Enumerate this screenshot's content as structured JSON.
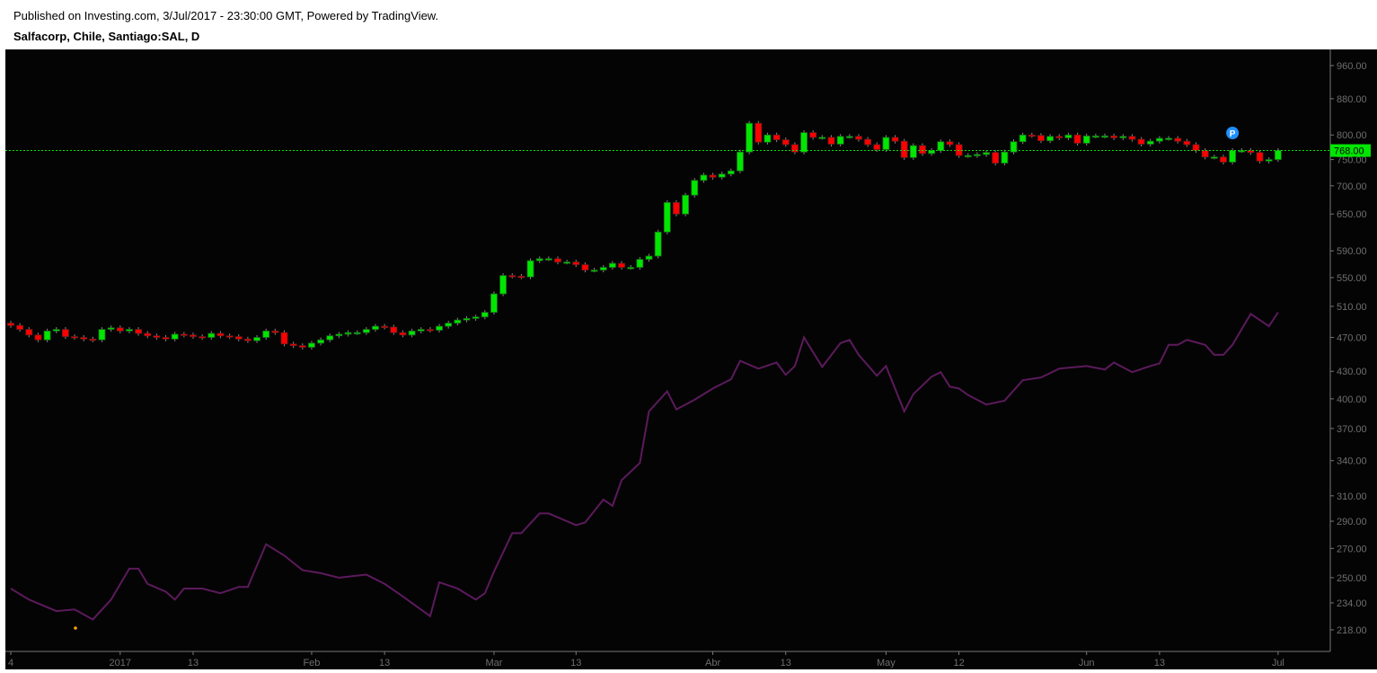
{
  "header": {
    "published": "Published on Investing.com, 3/Jul/2017 - 23:30:00 GMT, Powered by TradingView.",
    "symbol": "Salfacorp, Chile, Santiago:SAL, D"
  },
  "chart_data": {
    "type": "candlestick",
    "title": "Salfacorp, Chile, Santiago:SAL, D",
    "scale": "log",
    "ylim": [
      210,
      990
    ],
    "y_ticks": [
      "960.00",
      "880.00",
      "800.00",
      "750.00",
      "700.00",
      "650.00",
      "590.00",
      "550.00",
      "510.00",
      "470.00",
      "430.00",
      "400.00",
      "370.00",
      "340.00",
      "310.00",
      "290.00",
      "270.00",
      "250.00",
      "234.00",
      "218.00"
    ],
    "x_ticks": [
      {
        "label": "4",
        "index": 0
      },
      {
        "label": "2017",
        "index": 12
      },
      {
        "label": "13",
        "index": 20
      },
      {
        "label": "Feb",
        "index": 33
      },
      {
        "label": "13",
        "index": 41
      },
      {
        "label": "Mar",
        "index": 53
      },
      {
        "label": "13",
        "index": 62
      },
      {
        "label": "Abr",
        "index": 77
      },
      {
        "label": "13",
        "index": 85
      },
      {
        "label": "May",
        "index": 96
      },
      {
        "label": "12",
        "index": 104
      },
      {
        "label": "Jun",
        "index": 118
      },
      {
        "label": "13",
        "index": 126
      },
      {
        "label": "Jul",
        "index": 139
      }
    ],
    "last_price": "768.00",
    "last_value": 768,
    "colors": {
      "up": "#00e600",
      "down": "#ff0000",
      "compare": "#5c1a5c",
      "last": "#00e600"
    },
    "closes": [
      485,
      480,
      473,
      467,
      478,
      480,
      471,
      470,
      468,
      467,
      480,
      482,
      478,
      480,
      475,
      472,
      470,
      468,
      474,
      473,
      471,
      470,
      475,
      472,
      471,
      468,
      466,
      470,
      478,
      476,
      462,
      460,
      458,
      463,
      467,
      472,
      474,
      476,
      476,
      480,
      484,
      483,
      476,
      473,
      478,
      480,
      479,
      484,
      488,
      492,
      494,
      496,
      502,
      527,
      553,
      552,
      551,
      575,
      578,
      578,
      573,
      573,
      569,
      561,
      561,
      565,
      571,
      565,
      565,
      577,
      582,
      620,
      670,
      650,
      683,
      710,
      720,
      716,
      722,
      728,
      765,
      825,
      785,
      800,
      790,
      780,
      765,
      805,
      795,
      795,
      781,
      797,
      797,
      791,
      780,
      770,
      795,
      787,
      754,
      778,
      762,
      768,
      786,
      780,
      758,
      758,
      760,
      764,
      743,
      765,
      786,
      800,
      799,
      788,
      797,
      794,
      800,
      783,
      798,
      798,
      798,
      794,
      797,
      791,
      781,
      787,
      793,
      793,
      787,
      780,
      768,
      755,
      755,
      745,
      768,
      768,
      764,
      747,
      750,
      768
    ],
    "compare_series": [
      [
        0,
        243
      ],
      [
        2,
        236
      ],
      [
        5,
        229
      ],
      [
        7,
        230
      ],
      [
        9,
        224
      ],
      [
        11,
        236
      ],
      [
        13,
        256
      ],
      [
        14,
        256
      ],
      [
        15,
        246
      ],
      [
        17,
        241
      ],
      [
        18,
        236
      ],
      [
        19,
        243
      ],
      [
        21,
        243
      ],
      [
        23,
        240
      ],
      [
        25,
        244
      ],
      [
        26,
        244
      ],
      [
        28,
        273
      ],
      [
        30,
        265
      ],
      [
        32,
        255
      ],
      [
        34,
        253
      ],
      [
        36,
        250
      ],
      [
        39,
        252
      ],
      [
        41,
        246
      ],
      [
        43,
        238
      ],
      [
        46,
        226
      ],
      [
        47,
        247
      ],
      [
        49,
        243
      ],
      [
        51,
        236
      ],
      [
        52,
        240
      ],
      [
        53,
        254
      ],
      [
        55,
        281
      ],
      [
        56,
        281
      ],
      [
        58,
        296
      ],
      [
        59,
        296
      ],
      [
        62,
        287
      ],
      [
        63,
        289
      ],
      [
        65,
        307
      ],
      [
        66,
        302
      ],
      [
        67,
        323
      ],
      [
        69,
        338
      ],
      [
        70,
        387
      ],
      [
        72,
        408
      ],
      [
        73,
        389
      ],
      [
        75,
        399
      ],
      [
        77,
        411
      ],
      [
        79,
        421
      ],
      [
        80,
        442
      ],
      [
        82,
        433
      ],
      [
        84,
        440
      ],
      [
        85,
        426
      ],
      [
        86,
        436
      ],
      [
        87,
        470
      ],
      [
        89,
        435
      ],
      [
        91,
        463
      ],
      [
        92,
        467
      ],
      [
        93,
        449
      ],
      [
        95,
        425
      ],
      [
        96,
        436
      ],
      [
        98,
        387
      ],
      [
        99,
        405
      ],
      [
        101,
        424
      ],
      [
        102,
        429
      ],
      [
        103,
        413
      ],
      [
        104,
        411
      ],
      [
        105,
        404
      ],
      [
        107,
        394
      ],
      [
        109,
        398
      ],
      [
        111,
        420
      ],
      [
        113,
        423
      ],
      [
        115,
        433
      ],
      [
        118,
        436
      ],
      [
        120,
        432
      ],
      [
        121,
        440
      ],
      [
        123,
        429
      ],
      [
        125,
        436
      ],
      [
        126,
        439
      ],
      [
        127,
        461
      ],
      [
        128,
        461
      ],
      [
        129,
        467
      ],
      [
        131,
        461
      ],
      [
        132,
        449
      ],
      [
        133,
        449
      ],
      [
        134,
        461
      ],
      [
        136,
        500
      ],
      [
        138,
        484
      ],
      [
        139,
        502
      ]
    ],
    "marker": {
      "label": "P",
      "index": 134
    }
  }
}
